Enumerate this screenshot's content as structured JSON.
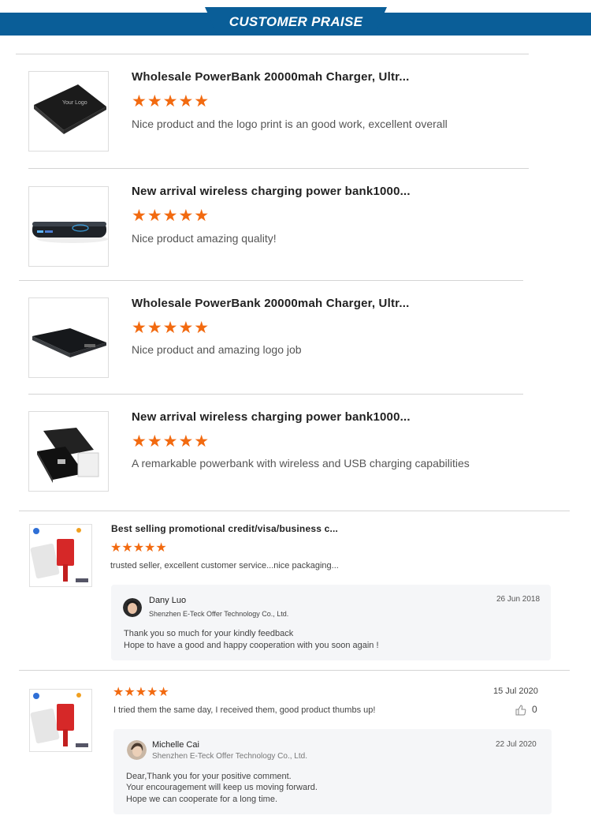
{
  "header": {
    "title": "CUSTOMER PRAISE",
    "color": "#0a5e98"
  },
  "reviews": [
    {
      "title": "Wholesale PowerBank 20000mah Charger, Ultr...",
      "stars": "★★★★★",
      "rating": 5,
      "comment": "Nice product and the logo print is an good work, excellent overall",
      "thumb_logo": "Your Logo"
    },
    {
      "title": "New arrival wireless charging power bank1000...",
      "stars": "★★★★★",
      "rating": 5,
      "comment": "Nice product amazing quality!"
    },
    {
      "title": "Wholesale PowerBank 20000mah Charger, Ultr...",
      "stars": "★★★★★",
      "rating": 5,
      "comment": "Nice product and amazing logo job"
    },
    {
      "title": "New arrival wireless charging power bank1000...",
      "stars": "★★★★★",
      "rating": 5,
      "comment": "A remarkable powerbank with wireless and USB charging capabilities"
    }
  ],
  "review5": {
    "title": "Best selling promotional credit/visa/business c...",
    "stars": "★★★★★",
    "rating": 5,
    "comment": "trusted seller, excellent customer service...nice packaging...",
    "reply": {
      "name": "Dany Luo",
      "company": "Shenzhen E-Teck Offer Technology Co., Ltd.",
      "date": "26 Jun 2018",
      "line1": "Thank you so much for your kindly feedback",
      "line2": "Hope to have a good and happy cooperation with you soon again !"
    }
  },
  "review6": {
    "stars": "★★★★★",
    "rating": 5,
    "date": "15 Jul 2020",
    "comment": "I tried them the same day, I received them, good product thumbs up!",
    "likes": "0",
    "reply": {
      "name": "Michelle Cai",
      "company": "Shenzhen E-Teck Offer Technology Co., Ltd.",
      "date": "22 Jul 2020",
      "line1": "Dear,Thank you for your positive comment.",
      "line2": "Your encouragement will keep us moving forward.",
      "line3": "Hope we can cooperate for a long time."
    }
  },
  "colors": {
    "star": "#f26a10",
    "brand": "#0a5e98",
    "reply_bg": "#f5f6f8"
  }
}
